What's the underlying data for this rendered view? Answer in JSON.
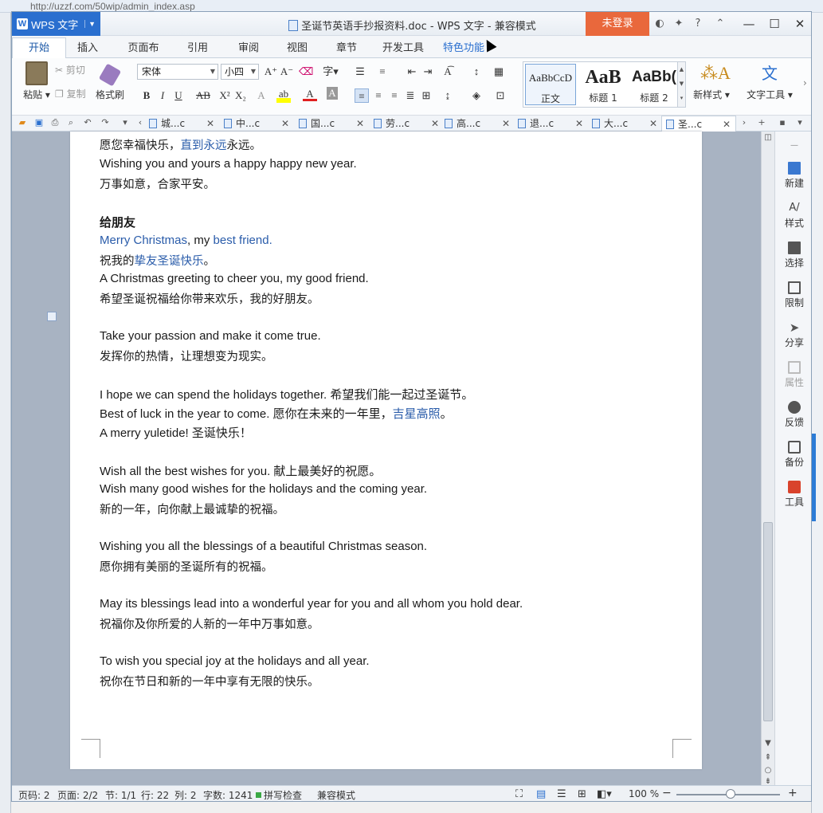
{
  "background": {
    "url": "http://uzzf.com/50wip/admin_index.asp"
  },
  "titlebar": {
    "app_menu": "WPS 文字",
    "document_title": "圣诞节英语手抄报资料.doc - WPS 文字 - 兼容模式",
    "login": "未登录",
    "accent": "#2a6fcf",
    "login_color": "#e9683c"
  },
  "tabs": [
    {
      "label": "开始"
    },
    {
      "label": "插入"
    },
    {
      "label": "页面布局"
    },
    {
      "label": "引用"
    },
    {
      "label": "审阅"
    },
    {
      "label": "视图"
    },
    {
      "label": "章节"
    },
    {
      "label": "开发工具"
    },
    {
      "label": "特色功能"
    }
  ],
  "ribbon": {
    "paste": "粘贴",
    "cut": "剪切",
    "copy": "复制",
    "format_painter": "格式刷",
    "font_name": "宋体",
    "font_size": "小四",
    "styles": [
      {
        "preview": "AaBbCcD",
        "label": "正文"
      },
      {
        "preview": "AaB",
        "label": "标题 1"
      },
      {
        "preview": "AaBb(",
        "label": "标题 2"
      }
    ],
    "new_style": "新样式",
    "text_tools": "文字工具"
  },
  "doc_tabs": [
    {
      "label": "城...c"
    },
    {
      "label": "中...c"
    },
    {
      "label": "国...c"
    },
    {
      "label": "劳...c"
    },
    {
      "label": "高...c"
    },
    {
      "label": "退...c"
    },
    {
      "label": "大...c"
    },
    {
      "label": "圣...c"
    }
  ],
  "document": {
    "l1": "愿您幸福快乐，",
    "l1b": "直到永远",
    "l1c": "永远。",
    "l2": "Wishing you and yours a happy happy new year.",
    "l3": "万事如意，合家平安。",
    "h1": "给朋友",
    "l4a": "Merry Christmas",
    "l4b": ", my ",
    "l4c": "best friend",
    "l4d": ".",
    "l5a": "祝我的",
    "l5b": "挚友圣诞快乐",
    "l5c": "。",
    "l6": "A Christmas greeting to cheer you, my good friend.",
    "l7": "希望圣诞祝福给你带来欢乐，我的好朋友。",
    "l8": "Take your passion and make it come true.",
    "l9": "发挥你的热情，让理想变为现实。",
    "l10": "I hope we can spend the holidays together. 希望我们能一起过圣诞节。",
    "l11a": "Best of luck in the year to come. 愿你在未来的一年里，",
    "l11b": "吉星高照",
    "l11c": "。",
    "l12": "A merry yuletide! 圣诞快乐！",
    "l13": "Wish all the best wishes for you. 献上最美好的祝愿。",
    "l14": "Wish many good wishes for the holidays and the coming year.",
    "l15": "新的一年，向你献上最诚挚的祝福。",
    "l16": "Wishing you all the blessings of a beautiful Christmas season.",
    "l17": "愿你拥有美丽的圣诞所有的祝福。",
    "l18": "May its blessings lead into a wonderful year for you and all whom you hold dear.",
    "l19": "祝福你及你所爱的人新的一年中万事如意。",
    "l20": "To wish you special joy at the holidays and all year.",
    "l21": "祝你在节日和新的一年中享有无限的快乐。",
    "link_color": "#2a5caa"
  },
  "side_panel": [
    {
      "label": "新建",
      "icon": "new-doc-icon"
    },
    {
      "label": "样式",
      "icon": "style-icon"
    },
    {
      "label": "选择",
      "icon": "select-icon"
    },
    {
      "label": "限制",
      "icon": "restrict-icon"
    },
    {
      "label": "分享",
      "icon": "share-icon"
    },
    {
      "label": "属性",
      "icon": "properties-icon"
    },
    {
      "label": "反馈",
      "icon": "feedback-icon"
    },
    {
      "label": "备份",
      "icon": "backup-icon"
    },
    {
      "label": "工具",
      "icon": "toolbox-icon"
    }
  ],
  "status": {
    "page_no": "页码: 2",
    "pages": "页面: 2/2",
    "section": "节: 1/1",
    "row": "行: 22",
    "col": "列: 2",
    "words": "字数: 1241",
    "spell": "拼写检查",
    "mode": "兼容模式",
    "zoom": "100 %"
  }
}
